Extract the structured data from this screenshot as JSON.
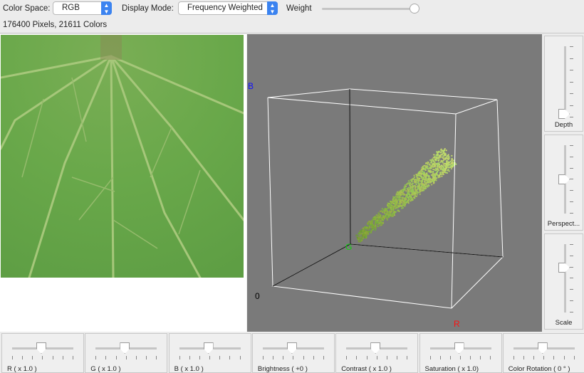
{
  "toolbar": {
    "color_space_label": "Color Space:",
    "color_space_value": "RGB",
    "display_mode_label": "Display Mode:",
    "display_mode_value": "Frequency Weighted",
    "weight_label": "Weight",
    "weight_value": 1.0
  },
  "status": "176400 Pixels,  21611 Colors",
  "plot": {
    "axis_b": "B",
    "axis_g": "G",
    "axis_r": "R",
    "origin": "0",
    "colors": {
      "b": "#1010ff",
      "g": "#10d010",
      "r": "#ff1010",
      "background": "#7a7a7a"
    }
  },
  "side_sliders": [
    {
      "label": "Depth",
      "value": 0.0
    },
    {
      "label": "Perspect...",
      "value": 0.5
    },
    {
      "label": "Scale",
      "value": 0.6
    }
  ],
  "bottom_sliders": [
    {
      "label": "R ( x 1.0 )",
      "value": 0.5
    },
    {
      "label": "G ( x 1.0 )",
      "value": 0.5
    },
    {
      "label": "B ( x 1.0 )",
      "value": 0.5
    },
    {
      "label": "Brightness ( +0 )",
      "value": 0.5
    },
    {
      "label": "Contrast ( x 1.0 )",
      "value": 0.5
    },
    {
      "label": "Saturation ( x 1.0)",
      "value": 0.5
    },
    {
      "label": "Color Rotation ( 0 ° )",
      "value": 0.5
    }
  ]
}
